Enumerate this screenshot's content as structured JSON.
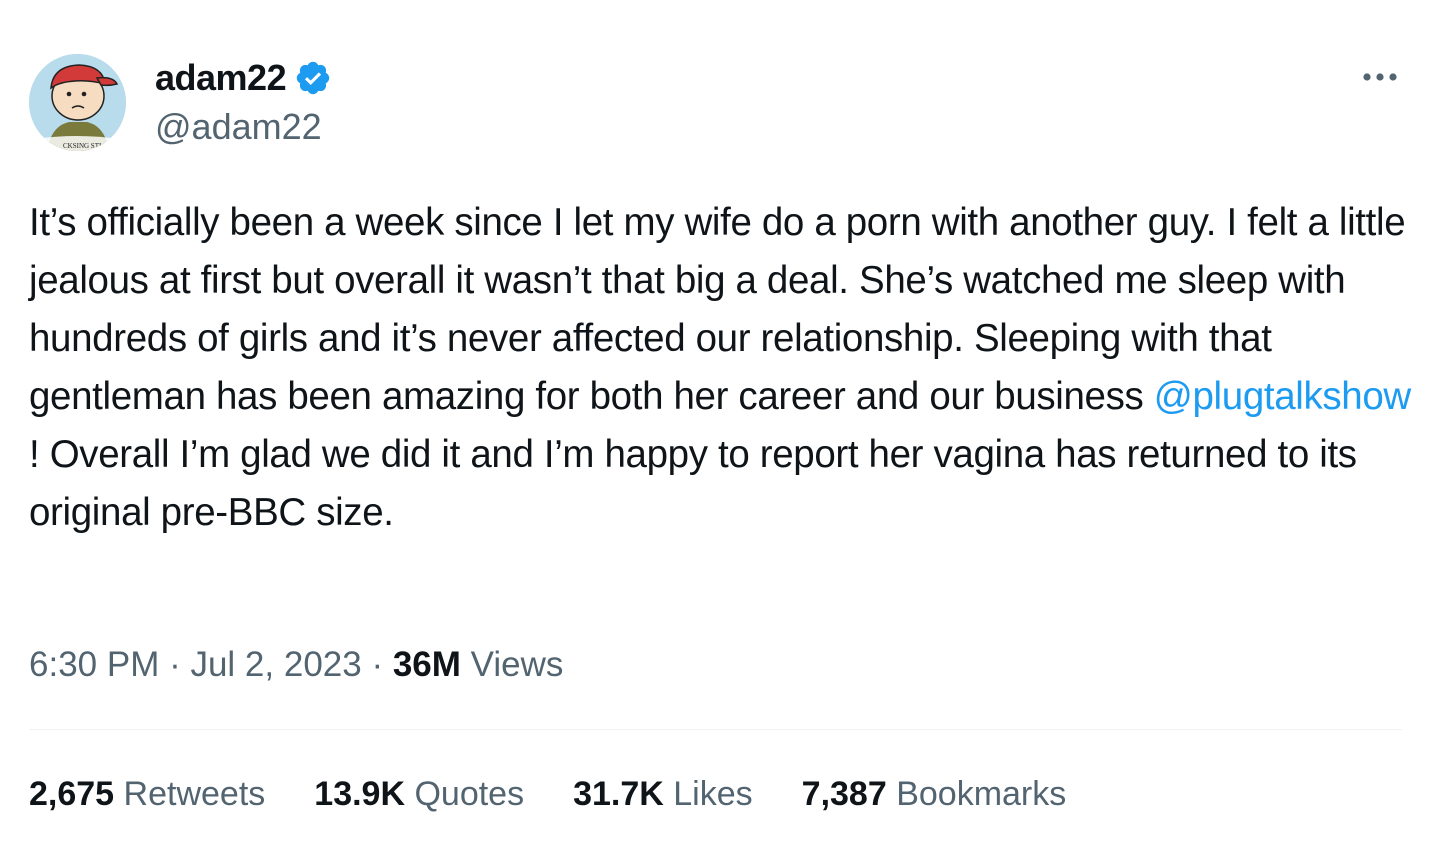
{
  "author": {
    "display_name": "adam22",
    "handle": "@adam22",
    "verified": true,
    "avatar_icon": "cartoon-avatar-icon",
    "avatar_caption": "CKSING STI"
  },
  "tweet": {
    "text_part1": "It’s officially been a week since I let my wife do a porn with another guy. I felt a little jealous at first but overall it wasn’t that big a deal. She’s watched me sleep with hundreds of girls and it’s never affected our relationship. Sleeping with that gentleman has been amazing for both her career and our business ",
    "mention": "@plugtalkshow",
    "text_part2": " ! Overall I’m glad we did it and I’m happy to report her vagina has returned to its original pre-BBC size."
  },
  "meta": {
    "time": "6:30 PM",
    "separator1": " · ",
    "date": "Jul 2, 2023",
    "separator2": " · ",
    "views_count": "36M",
    "views_label": " Views"
  },
  "stats": {
    "retweets_count": "2,675",
    "retweets_label": " Retweets",
    "quotes_count": "13.9K",
    "quotes_label": " Quotes",
    "likes_count": "31.7K",
    "likes_label": " Likes",
    "bookmarks_count": "7,387",
    "bookmarks_label": " Bookmarks"
  },
  "colors": {
    "accent": "#1d9bf0",
    "text_primary": "#0f1419",
    "text_secondary": "#536471",
    "divider": "#eff3f4"
  },
  "icons": {
    "verified": "verified-badge-icon",
    "more": "more-options-icon"
  }
}
